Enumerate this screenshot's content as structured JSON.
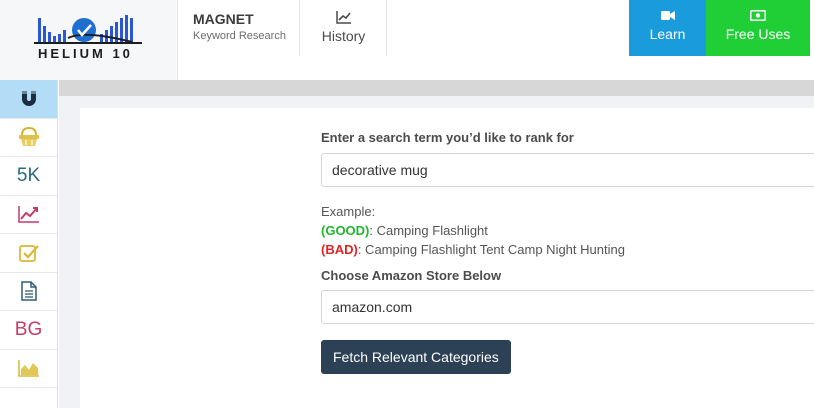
{
  "brand": {
    "logo_text": "HELIUM 10"
  },
  "header": {
    "app_name": "MAGNET",
    "app_subtitle": "Keyword Research",
    "history_label": "History",
    "learn_label": "Learn",
    "free_uses_label": "Free Uses"
  },
  "sidebar": {
    "items": [
      {
        "icon": "magnet-icon",
        "text": ""
      },
      {
        "icon": "basket-icon",
        "text": ""
      },
      {
        "icon": "5k-icon",
        "text": "5K"
      },
      {
        "icon": "trend-chart-icon",
        "text": ""
      },
      {
        "icon": "checklist-icon",
        "text": ""
      },
      {
        "icon": "document-icon",
        "text": ""
      },
      {
        "icon": "bg-icon",
        "text": "BG"
      },
      {
        "icon": "area-chart-icon",
        "text": ""
      }
    ]
  },
  "form": {
    "search_label": "Enter a search term you’d like to rank for",
    "search_value": "decorative mug",
    "example_label": "Example:",
    "good_tag": "(GOOD)",
    "good_text": ": Camping Flashlight",
    "bad_tag": "(BAD)",
    "bad_text": ": Camping Flashlight Tent Camp Night Hunting",
    "store_label": "Choose Amazon Store Below",
    "store_value": "amazon.com",
    "fetch_button": "Fetch Relevant Categories"
  },
  "colors": {
    "learn": "#1a9bdc",
    "free_uses": "#1fcf35",
    "fetch_button": "#2c4156",
    "good": "#1fb82c",
    "bad": "#e12424",
    "sidebar_active": "#b3dcf6"
  }
}
